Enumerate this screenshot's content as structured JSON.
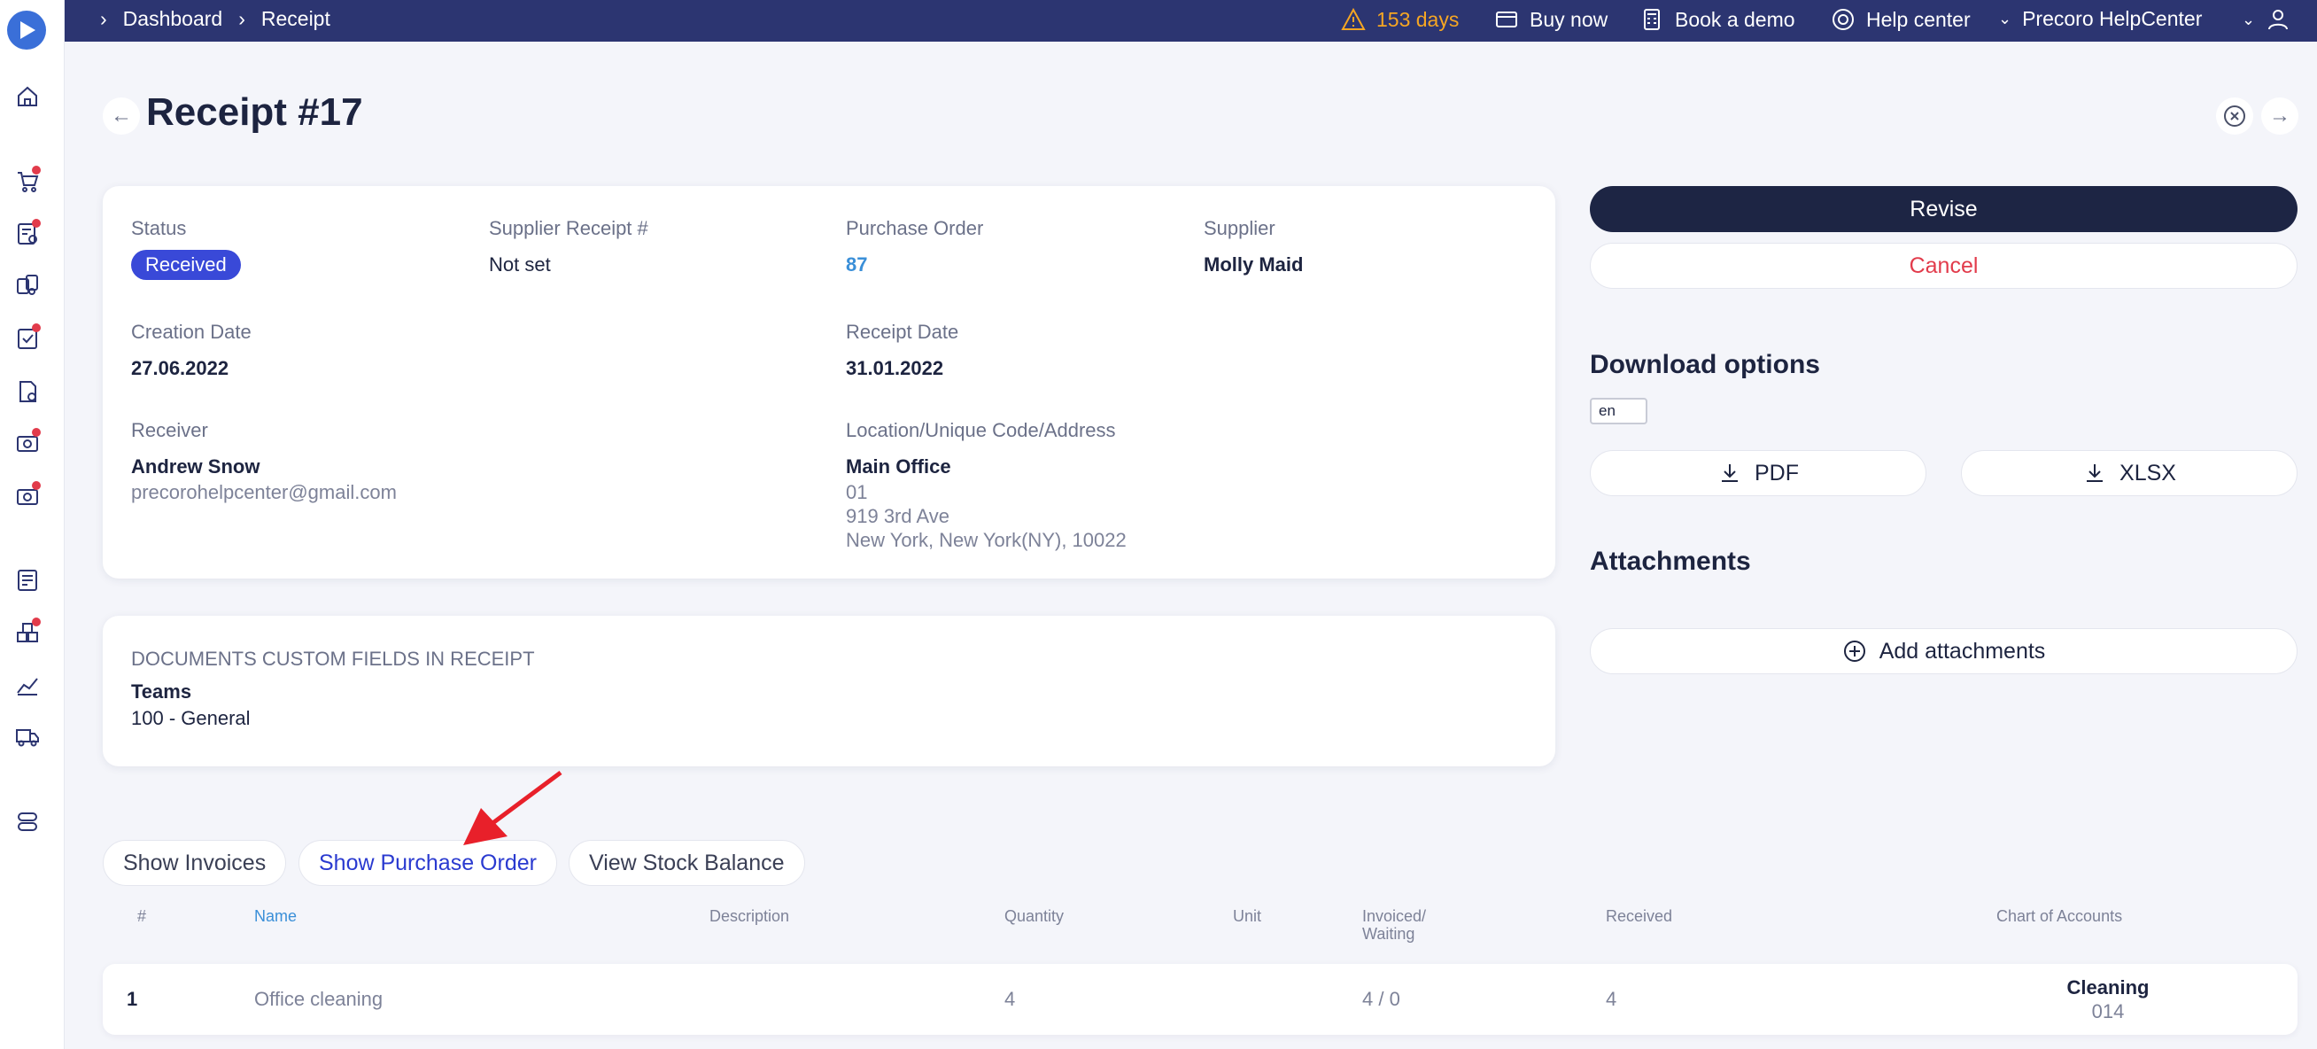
{
  "topbar": {
    "breadcrumb": [
      "Dashboard",
      "Receipt"
    ],
    "trial": "153 days",
    "buy_now": "Buy now",
    "book_demo": "Book a demo",
    "help_center": "Help center",
    "account": "Precoro HelpCenter"
  },
  "page": {
    "title": "Receipt #17"
  },
  "details": {
    "status_label": "Status",
    "status_value": "Received",
    "supplier_receipt_label": "Supplier Receipt #",
    "supplier_receipt_value": "Not set",
    "po_label": "Purchase Order",
    "po_value": "87",
    "supplier_label": "Supplier",
    "supplier_value": "Molly Maid",
    "creation_date_label": "Creation Date",
    "creation_date_value": "27.06.2022",
    "receipt_date_label": "Receipt Date",
    "receipt_date_value": "31.01.2022",
    "receiver_label": "Receiver",
    "receiver_name": "Andrew Snow",
    "receiver_email": "precorohelpcenter@gmail.com",
    "location_label": "Location/Unique Code/Address",
    "location_name": "Main Office",
    "location_code": "01",
    "location_street": "919 3rd Ave",
    "location_city": "New York, New York(NY), 10022"
  },
  "custom_fields": {
    "heading": "DOCUMENTS CUSTOM FIELDS IN RECEIPT",
    "field_label": "Teams",
    "field_value": "100 - General"
  },
  "actions": {
    "revise": "Revise",
    "cancel": "Cancel",
    "download_title": "Download options",
    "language": "en",
    "pdf": "PDF",
    "xlsx": "XLSX",
    "attachments_title": "Attachments",
    "add_attachments": "Add attachments"
  },
  "tabs": {
    "show_invoices": "Show Invoices",
    "show_po": "Show Purchase Order",
    "view_stock": "View Stock Balance"
  },
  "table": {
    "headers": {
      "num": "#",
      "name": "Name",
      "description": "Description",
      "quantity": "Quantity",
      "unit": "Unit",
      "invoiced_1": "Invoiced/",
      "invoiced_2": "Waiting",
      "received": "Received",
      "chart": "Chart of Accounts"
    },
    "rows": [
      {
        "num": "1",
        "name": "Office cleaning",
        "quantity": "4",
        "invoiced": "4 / 0",
        "received": "4",
        "chart_name": "Cleaning",
        "chart_code": "014"
      }
    ]
  },
  "colors": {
    "topbar": "#2c3571",
    "primary_button": "#1d2544",
    "badge": "#3949d8",
    "danger": "#e23b4b",
    "link": "#3a8fd8",
    "warning": "#f5a623",
    "annotation_arrow": "#e8202a"
  }
}
